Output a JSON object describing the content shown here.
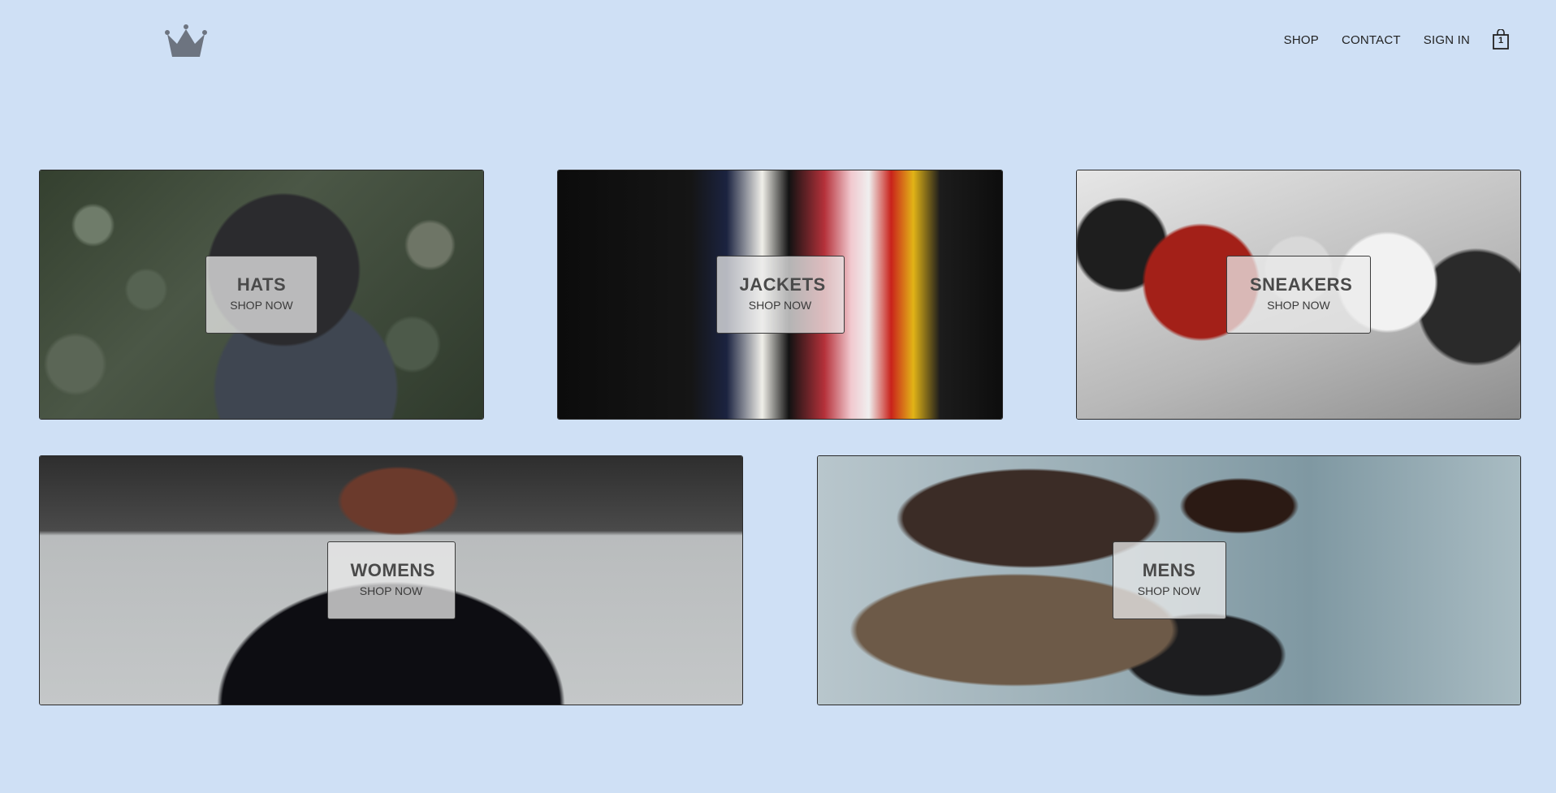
{
  "header": {
    "logo_icon": "crown-icon",
    "nav": [
      {
        "label": "SHOP"
      },
      {
        "label": "CONTACT"
      },
      {
        "label": "SIGN IN"
      }
    ],
    "cart": {
      "icon": "shopping-bag-icon",
      "count": "1"
    }
  },
  "directory": {
    "items": [
      {
        "title": "HATS",
        "subtitle": "SHOP NOW"
      },
      {
        "title": "JACKETS",
        "subtitle": "SHOP NOW"
      },
      {
        "title": "SNEAKERS",
        "subtitle": "SHOP NOW"
      },
      {
        "title": "WOMENS",
        "subtitle": "SHOP NOW"
      },
      {
        "title": "MENS",
        "subtitle": "SHOP NOW"
      }
    ]
  },
  "colors": {
    "page_background": "#cfe0f5",
    "overlay_background": "#ebebebbf",
    "text_dark": "#4a4a4a"
  }
}
